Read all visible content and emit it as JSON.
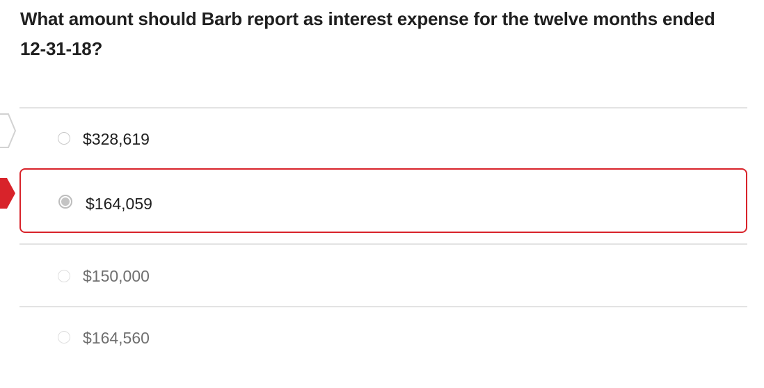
{
  "question": {
    "text": "What amount should Barb report as interest expense for the twelve months ended 12-31-18?"
  },
  "options": [
    {
      "label": "$328,619",
      "state": "unselected"
    },
    {
      "label": "$164,059",
      "state": "selected"
    },
    {
      "label": "$150,000",
      "state": "disabled"
    },
    {
      "label": "$164,560",
      "state": "disabled"
    }
  ],
  "colors": {
    "selected_border": "#d8232a",
    "marker_red": "#d8232a",
    "divider": "#e3e3e3"
  },
  "icons": {
    "previous_marker": "chevron-marker-icon",
    "current_marker": "current-answer-marker-icon"
  }
}
